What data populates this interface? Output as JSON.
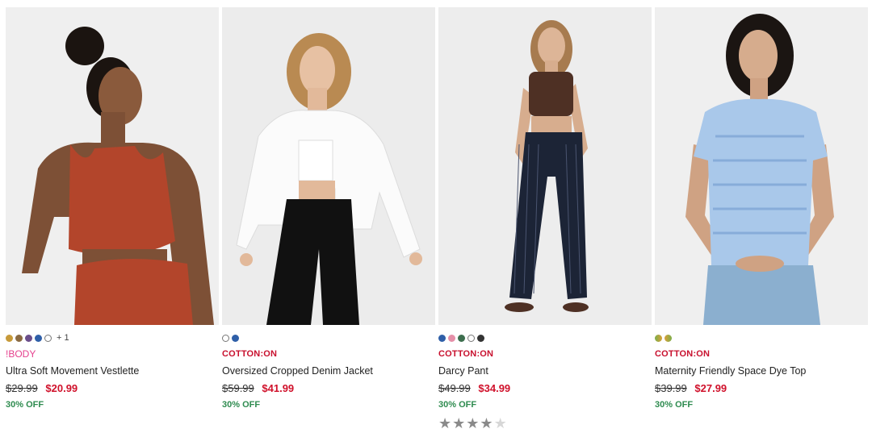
{
  "products": [
    {
      "swatches": [
        "#c79a3a",
        "#8a6a42",
        "#6b4e8a",
        "#2f5fa8",
        "outline"
      ],
      "more_colors": "+ 1",
      "brand": "!BODY",
      "name": "Ultra Soft Movement Vestlette",
      "old_price": "$29.99",
      "new_price": "$20.99",
      "discount": "30% OFF",
      "image_alt": "Woman wearing rust-coloured sports crop top"
    },
    {
      "swatches": [
        "outline",
        "#2f5fa8"
      ],
      "brand": "COTTON:ON",
      "name": "Oversized Cropped Denim Jacket",
      "old_price": "$59.99",
      "new_price": "$41.99",
      "discount": "30% OFF",
      "image_alt": "Woman wearing white cropped denim jacket and black jeans"
    },
    {
      "swatches": [
        "#2f5fa8",
        "#e58fa8",
        "#3d6e4e",
        "outline",
        "#333333"
      ],
      "brand": "COTTON:ON",
      "name": "Darcy Pant",
      "old_price": "$49.99",
      "new_price": "$34.99",
      "discount": "30% OFF",
      "rating": 4,
      "image_alt": "Woman wearing brown crop top and navy pinstripe pants"
    },
    {
      "swatches": [
        "#7cae4a",
        "#d9a03a"
      ],
      "brand": "COTTON:ON",
      "name": "Maternity Friendly Space Dye Top",
      "old_price": "$39.99",
      "new_price": "$27.99",
      "discount": "30% OFF",
      "image_alt": "Pregnant woman wearing blue space dye t-shirt"
    }
  ],
  "colors": {
    "brand_cotton_on": "#c8102e",
    "brand_body": "#e5418e",
    "sale_price": "#d0112b",
    "discount": "#2e8b4f"
  }
}
